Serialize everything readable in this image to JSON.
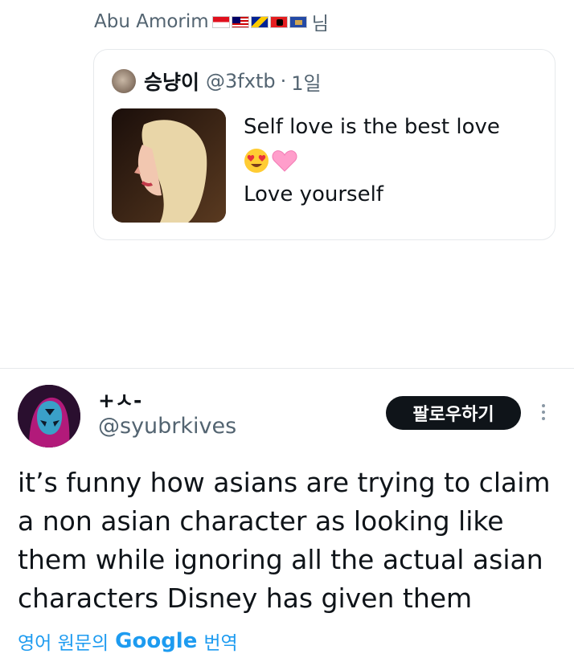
{
  "reply_context": {
    "author": "Abu Amorim",
    "flags": [
      {
        "name": "indonesia-flag",
        "colors": [
          "#e0101d",
          "#ffffff"
        ]
      },
      {
        "name": "malaysia-flag",
        "colors": [
          "#cc0001",
          "#010066"
        ]
      },
      {
        "name": "bosnia-flag",
        "colors": [
          "#002395",
          "#fecb00"
        ]
      },
      {
        "name": "albania-flag",
        "colors": [
          "#e41e20",
          "#000000"
        ]
      },
      {
        "name": "kosovo-flag",
        "colors": [
          "#244aa5",
          "#d0a650"
        ]
      }
    ],
    "suffix": "님"
  },
  "quote": {
    "name": "승냥이",
    "handle": "@3fxtb",
    "separator": "·",
    "time": "1일",
    "line1": "Self love is the best love",
    "emoji": [
      "heart-eyes-emoji",
      "pink-heart-emoji"
    ],
    "line3": "Love yourself"
  },
  "tweet": {
    "name": "+ㅅ-",
    "handle": "@syubrkives",
    "follow_label": "팔로우하기",
    "text": "it’s funny how asians are trying to claim a non asian character as looking like them while ignoring all the actual asian characters Disney has given them"
  },
  "translate": {
    "prefix": "영어 원문의",
    "brand": "Google",
    "suffix": "번역"
  },
  "colors": {
    "accent": "#1d9bf0",
    "text_primary": "#0f1419",
    "text_secondary": "#536471",
    "follow_bg": "#0f1419"
  }
}
